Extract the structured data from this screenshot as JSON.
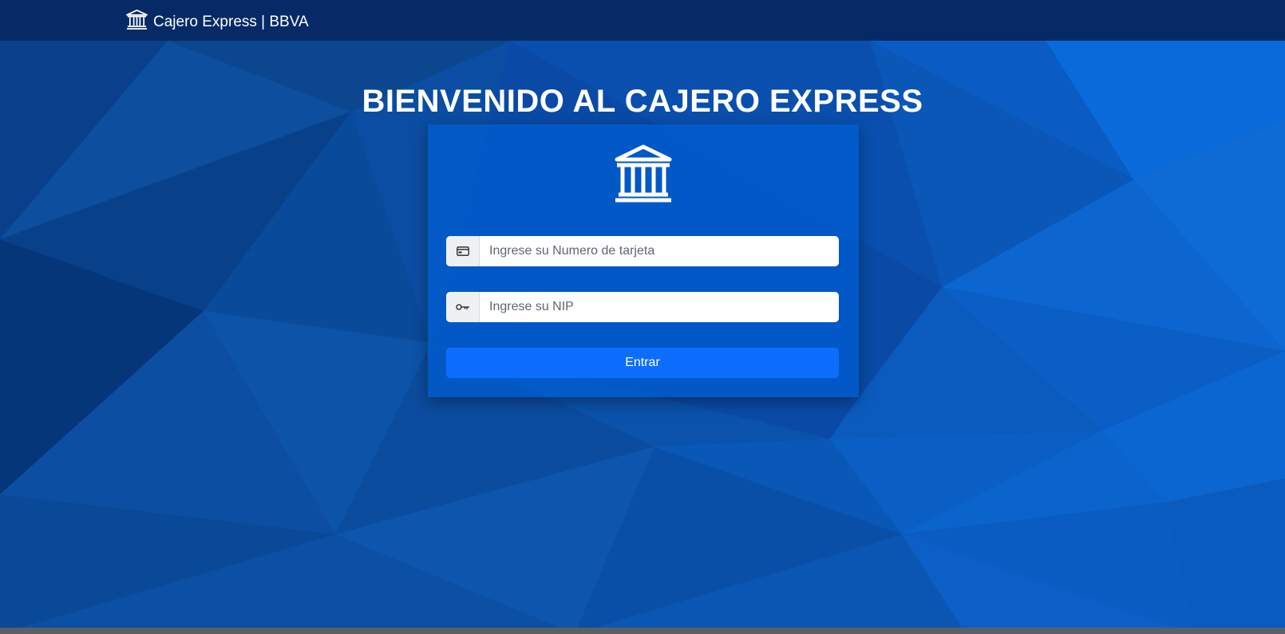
{
  "navbar": {
    "brand_label": "Cajero Express | BBVA",
    "brand_icon": "bank-icon"
  },
  "main": {
    "title": "BIENVENIDO AL CAJERO EXPRESS"
  },
  "login_card": {
    "icon": "bank-icon",
    "card_number": {
      "prefix_icon": "credit-card-icon",
      "placeholder": "Ingrese su Numero de tarjeta",
      "value": ""
    },
    "pin": {
      "prefix_icon": "key-icon",
      "placeholder": "Ingrese su NIP",
      "value": ""
    },
    "submit_label": "Entrar"
  },
  "colors": {
    "navbar": "#062a66",
    "background": "#0a4aa6",
    "button": "#0d6efd"
  }
}
